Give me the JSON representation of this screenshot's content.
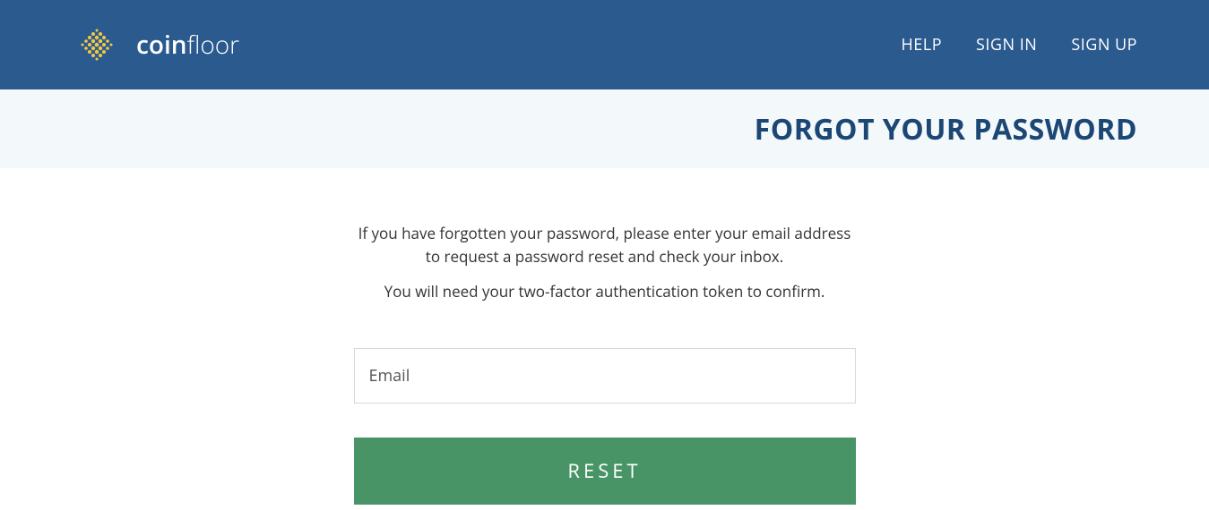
{
  "header": {
    "logo_text_bold": "coin",
    "logo_text_light": "floor",
    "nav": {
      "help": "HELP",
      "signin": "SIGN IN",
      "signup": "SIGN UP"
    }
  },
  "banner": {
    "title": "FORGOT YOUR PASSWORD"
  },
  "content": {
    "description1": "If you have forgotten your password, please enter your email address to request a password reset and check your inbox.",
    "description2": "You will need your two-factor authentication token to confirm.",
    "email_placeholder": "Email",
    "reset_button": "RESET"
  }
}
